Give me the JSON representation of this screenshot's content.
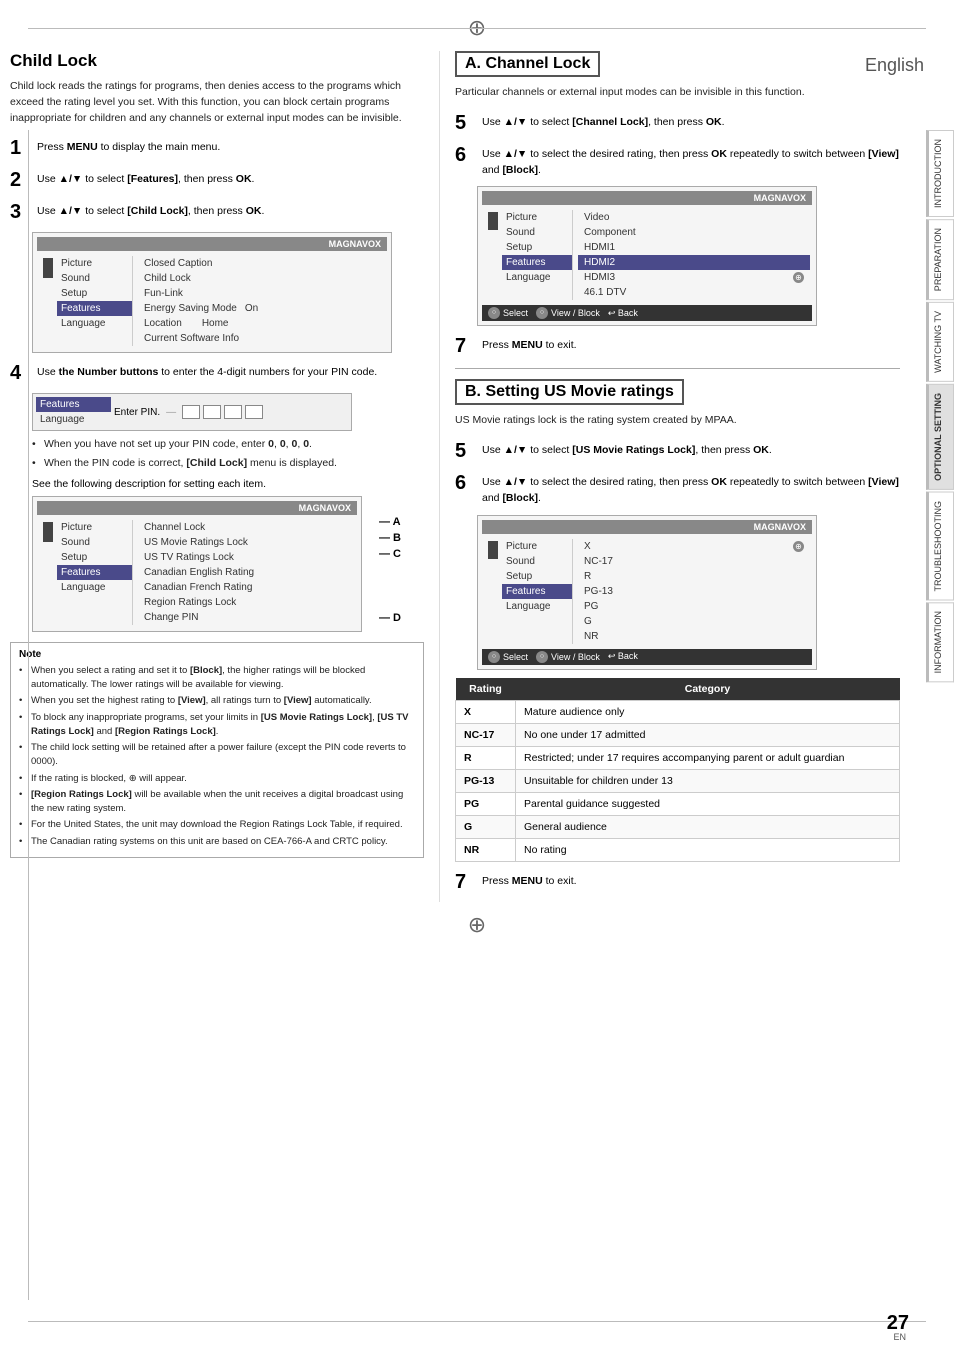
{
  "page": {
    "title": "Child Lock",
    "language": "English",
    "page_number": "27",
    "page_en": "EN"
  },
  "tabs": {
    "items": [
      {
        "label": "INTRODUCTION"
      },
      {
        "label": "PREPARATION"
      },
      {
        "label": "WATCHING TV"
      },
      {
        "label": "OPTIONAL SETTING",
        "active": true
      },
      {
        "label": "TROUBLESHOOTING"
      },
      {
        "label": "INFORMATION"
      }
    ]
  },
  "left_column": {
    "title": "Child Lock",
    "description": "Child lock reads the ratings for programs, then denies access to the programs which exceed the rating level you set. With this function, you can block certain programs inappropriate for children and any channels or external input modes can be invisible.",
    "steps": [
      {
        "number": "1",
        "text": "Press MENU to display the main menu."
      },
      {
        "number": "2",
        "text": "Use ▲/▼ to select [Features], then press OK."
      },
      {
        "number": "3",
        "text": "Use ▲/▼ to select [Child Lock], then press OK."
      }
    ],
    "menu1": {
      "brand": "MAGNAVOX",
      "items_left": [
        "Picture",
        "Sound",
        "Setup",
        "Features",
        "Language"
      ],
      "items_right": [
        "Closed Caption",
        "Child Lock",
        "Fun-Link",
        "Energy Saving Mode",
        "Location",
        "Current Software Info"
      ],
      "highlighted_left": "Features",
      "highlighted_right": "",
      "extra_values": {
        "Energy Saving Mode": "On",
        "Location": "Home"
      }
    },
    "step4": {
      "number": "4",
      "text": "Use the Number buttons to enter the 4-digit numbers for your PIN code."
    },
    "pin_menu": {
      "items_left": [
        "Features",
        "Language"
      ],
      "highlighted_left": "Features",
      "pin_label": "Enter PIN.",
      "squares": 4
    },
    "bullet_points_pin": [
      "When you have not set up your PIN code, enter 0, 0, 0, 0.",
      "When the PIN code is correct, [Child Lock] menu is displayed."
    ],
    "see_text": "See the following description for setting each item.",
    "menu2": {
      "brand": "MAGNAVOX",
      "items_left": [
        "Picture",
        "Sound",
        "Setup",
        "Features",
        "Language"
      ],
      "items_right": [
        "Channel Lock",
        "US Movie Ratings Lock",
        "US TV Ratings Lock",
        "Canadian English Rating",
        "Canadian French Rating",
        "Region Ratings Lock",
        "Change PIN"
      ],
      "highlighted_left": "Features",
      "labels": {
        "Channel Lock": "A",
        "US Movie Ratings Lock": "B",
        "US TV Ratings Lock": "C",
        "Change PIN": "D"
      }
    },
    "note": {
      "title": "Note",
      "items": [
        "When you select a rating and set it to [Block], the higher ratings will be blocked automatically. The lower ratings will be available for viewing.",
        "When you set the highest rating to [View], all ratings turn to [View] automatically.",
        "To block any inappropriate programs, set your limits in [US Movie Ratings Lock], [US TV Ratings Lock] and [Region Ratings Lock].",
        "The child lock setting will be retained after a power failure (except the PIN code reverts to 0000).",
        "If the rating is blocked, ⊕ will appear.",
        "[Region Ratings Lock] will be available when the unit receives a digital broadcast using the new rating system.",
        "For the United States, the unit may download the Region Ratings Lock Table, if required.",
        "The Canadian rating systems on this unit are based on CEA-766-A and CRTC policy."
      ]
    }
  },
  "right_column": {
    "section_a": {
      "title": "A. Channel Lock",
      "description": "Particular channels or external input modes can be invisible in this function.",
      "steps": [
        {
          "number": "5",
          "text": "Use ▲/▼ to select [Channel Lock], then press OK."
        },
        {
          "number": "6",
          "text": "Use ▲/▼ to select the desired rating, then press OK repeatedly to switch between [View] and [Block]."
        }
      ],
      "menu": {
        "brand": "MAGNAVOX",
        "items_left": [
          "Picture",
          "Sound",
          "Setup",
          "Features",
          "Language"
        ],
        "items_right": [
          "Video",
          "Component",
          "HDMI 1",
          "HDMI 2",
          "HDMI 3",
          "46.1 DTV"
        ],
        "highlighted_right": "HDMI 2",
        "circle_icon": "HDMI 3"
      },
      "step7": {
        "number": "7",
        "text": "Press MENU to exit."
      }
    },
    "section_b": {
      "title": "B. Setting US Movie ratings",
      "description": "US Movie ratings lock is the rating system created by MPAA.",
      "steps": [
        {
          "number": "5",
          "text": "Use ▲/▼ to select [US Movie Ratings Lock], then press OK."
        },
        {
          "number": "6",
          "text": "Use ▲/▼ to select the desired rating, then press OK repeatedly to switch between [View] and [Block]."
        }
      ],
      "menu": {
        "brand": "MAGNAVOX",
        "items_left": [
          "Picture",
          "Sound",
          "Setup",
          "Features",
          "Language"
        ],
        "items_right": [
          "X",
          "NC-17",
          "R",
          "PG-13",
          "PG",
          "G",
          "NR"
        ],
        "highlighted_right": "X",
        "circle_icon": "X"
      },
      "rating_table": {
        "headers": [
          "Rating",
          "Category"
        ],
        "rows": [
          {
            "rating": "X",
            "category": "Mature audience only"
          },
          {
            "rating": "NC-17",
            "category": "No one under 17 admitted"
          },
          {
            "rating": "R",
            "category": "Restricted; under 17 requires accompanying parent or adult guardian"
          },
          {
            "rating": "PG-13",
            "category": "Unsuitable for children under 13"
          },
          {
            "rating": "PG",
            "category": "Parental guidance suggested"
          },
          {
            "rating": "G",
            "category": "General audience"
          },
          {
            "rating": "NR",
            "category": "No rating"
          }
        ]
      },
      "step7": {
        "number": "7",
        "text": "Press MENU to exit."
      }
    }
  }
}
